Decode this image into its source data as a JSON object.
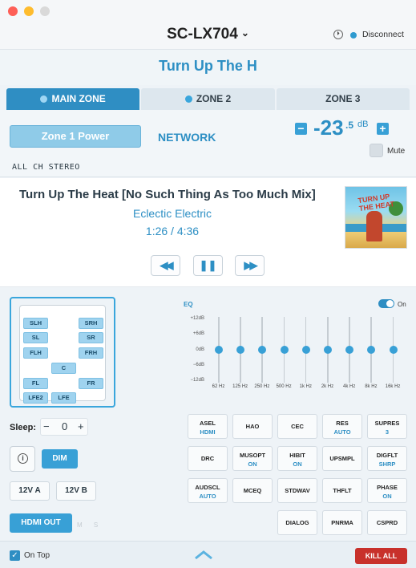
{
  "window": {
    "device_name": "SC-LX704",
    "disconnect_label": "Disconnect"
  },
  "banner": {
    "title": "Turn Up The H"
  },
  "tabs": [
    {
      "label": "MAIN ZONE",
      "active": true
    },
    {
      "label": "ZONE 2",
      "active": false
    },
    {
      "label": "ZONE 3",
      "active": false
    }
  ],
  "zone": {
    "power_label": "Zone 1 Power",
    "input": "NETWORK",
    "volume": "-23",
    "volume_decimal": ".5",
    "volume_unit": "dB",
    "volume_minus": "−",
    "volume_plus": "+",
    "mute_label": "Mute",
    "listening_mode": "ALL CH STEREO"
  },
  "now_playing": {
    "track": "Turn Up The Heat [No Such Thing As Too Much Mix]",
    "artist": "Eclectic Electric",
    "time": "1:26 / 4:36",
    "art_text": "TURN UP THE HEAT",
    "prev_icon": "◀◀",
    "pause_icon": "❚❚",
    "next_icon": "▶▶"
  },
  "speakers": [
    "SLH",
    "SRH",
    "SL",
    "SR",
    "FLH",
    "FRH",
    "C",
    "FL",
    "FR",
    "LFE2",
    "LFE"
  ],
  "eq": {
    "label": "EQ",
    "toggle_label": "On",
    "enabled": true,
    "db_labels": [
      "+12dB",
      "+6dB",
      "0dB",
      "−6dB",
      "−12dB"
    ],
    "bands": [
      "62 Hz",
      "125 Hz",
      "250 Hz",
      "500 Hz",
      "1k Hz",
      "2k Hz",
      "4k Hz",
      "8k Hz",
      "16k Hz"
    ],
    "gains_db": [
      0,
      0,
      0,
      0,
      0,
      0,
      0,
      0,
      0
    ]
  },
  "controls": {
    "sleep_label": "Sleep:",
    "sleep_minus": "−",
    "sleep_value": "0",
    "sleep_plus": "+",
    "info_glyph": "i",
    "dim_label": "DIM",
    "trigger_a": "12V A",
    "trigger_b": "12V B",
    "hdmi_out": "HDMI OUT",
    "hdmi_out_options": "M S"
  },
  "commands": [
    {
      "label": "ASEL",
      "value": "HDMI"
    },
    {
      "label": "HAO",
      "value": ""
    },
    {
      "label": "CEC",
      "value": ""
    },
    {
      "label": "RES",
      "value": "AUTO"
    },
    {
      "label": "SUPRES",
      "value": "3"
    },
    {
      "label": "DRC",
      "value": ""
    },
    {
      "label": "MUSOPT",
      "value": "ON"
    },
    {
      "label": "HIBIT",
      "value": "ON"
    },
    {
      "label": "UPSMPL",
      "value": ""
    },
    {
      "label": "DIGFLT",
      "value": "SHRP"
    },
    {
      "label": "AUDSCL",
      "value": "AUTO"
    },
    {
      "label": "MCEQ",
      "value": ""
    },
    {
      "label": "STDWAV",
      "value": ""
    },
    {
      "label": "THFLT",
      "value": ""
    },
    {
      "label": "PHASE",
      "value": "ON"
    },
    {
      "label": "DIALOG",
      "value": ""
    },
    {
      "label": "PNRMA",
      "value": ""
    },
    {
      "label": "CSPRD",
      "value": ""
    }
  ],
  "footer": {
    "on_top_label": "On Top",
    "on_top_checked": true,
    "kill_all_label": "KILL ALL"
  },
  "colors": {
    "accent": "#2f8ec3",
    "accent_light": "#38a0d6",
    "kill": "#c8312b"
  }
}
